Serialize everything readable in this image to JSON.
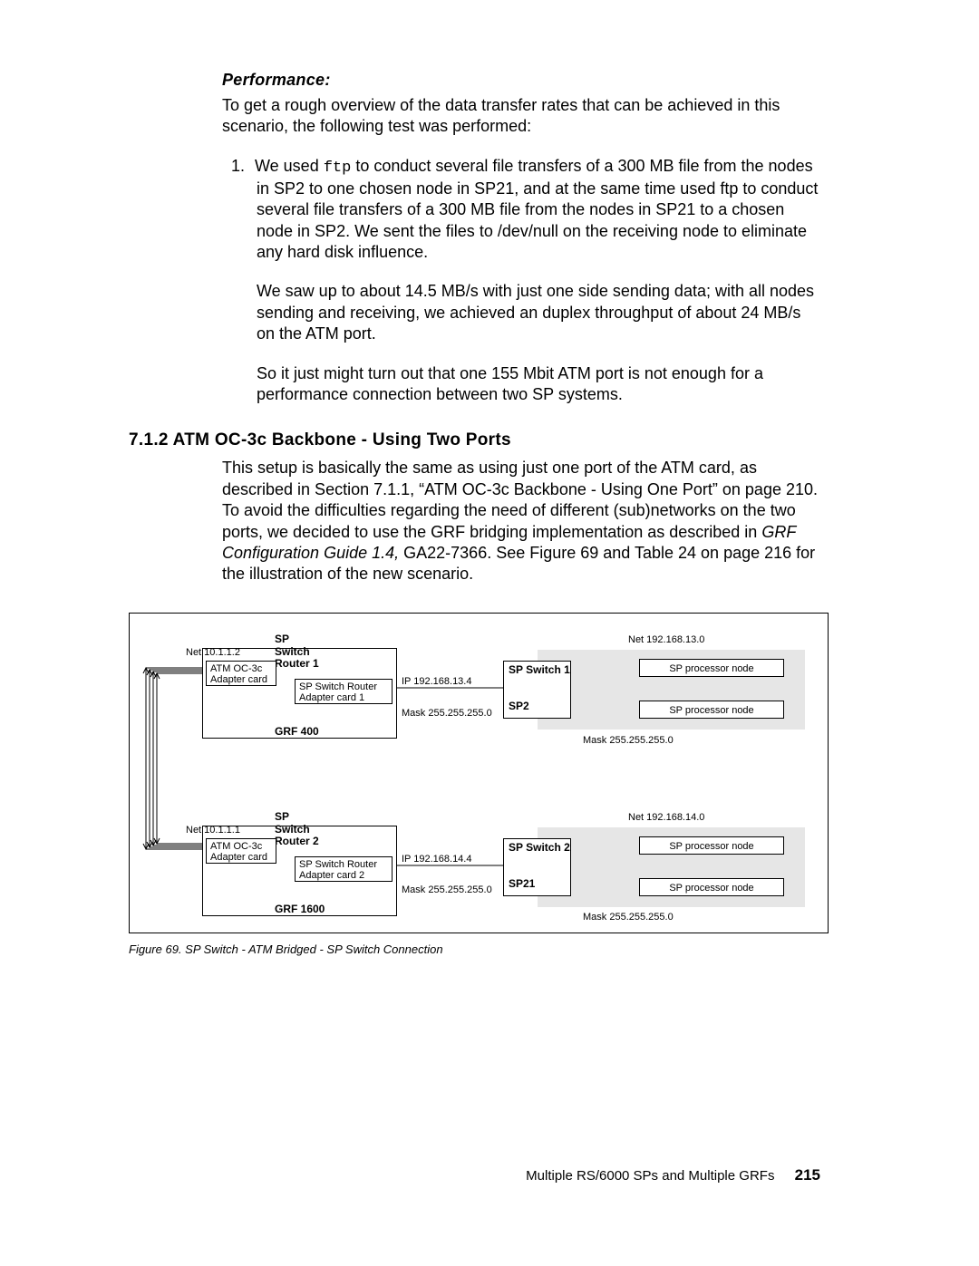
{
  "performance": {
    "heading": "Performance:",
    "intro": "To get a rough overview of the data transfer rates that can be achieved in this scenario, the following test was performed:",
    "item_number": "1.",
    "item_text_a": "We used ",
    "item_text_ftp": "ftp",
    "item_text_b": " to conduct several file transfers of a 300 MB file from the nodes in SP2 to one chosen node in SP21, and at the same time used ftp to conduct several file transfers of a 300 MB file from the nodes in SP21 to a chosen node in SP2. We sent the files to /dev/null on the receiving node to eliminate any hard disk influence.",
    "p2": "We saw up to about 14.5 MB/s with just one side sending data; with all nodes sending and receiving, we achieved an duplex throughput of about 24 MB/s on the ATM port.",
    "p3": "So it just might turn out that one 155 Mbit ATM port is not enough for a performance connection between two SP systems."
  },
  "section": {
    "heading": "7.1.2  ATM OC-3c Backbone - Using Two Ports",
    "body_a": "This setup is basically the same as using just one port of the ATM card, as described in Section 7.1.1, “ATM OC-3c Backbone - Using One Port” on page 210. To avoid the difficulties regarding the need of different (sub)networks on the two ports, we decided to use the GRF bridging implementation as described in ",
    "body_ref": "GRF Configuration Guide 1.4,",
    "body_b": " GA22-7366. See Figure 69 and Table 24 on page 216 for the illustration of the new scenario."
  },
  "figure": {
    "caption": "Figure 69.  SP Switch - ATM Bridged - SP Switch Connection",
    "router1": {
      "title": "SP\nSwitch\nRouter 1",
      "device": "GRF 400",
      "atm_card": "ATM OC-3c\nAdapter card",
      "sp_card": "SP Switch Router\nAdapter card 1",
      "net_left": "Net 10.1.1.2",
      "ip": "IP 192.168.13.4",
      "mask": "Mask 255.255.255.0"
    },
    "router2": {
      "title": "SP\nSwitch\nRouter 2",
      "device": "GRF 1600",
      "atm_card": "ATM OC-3c\nAdapter card",
      "sp_card": "SP Switch Router\nAdapter card 2",
      "net_left": "Net 10.1.1.1",
      "ip": "IP 192.168.14.4",
      "mask": "Mask 255.255.255.0"
    },
    "sp1": {
      "switch_label": "SP Switch 1",
      "name": "SP2",
      "net": "Net 192.168.13.0",
      "mask": "Mask 255.255.255.0",
      "node": "SP processor node"
    },
    "sp2": {
      "switch_label": "SP Switch 2",
      "name": "SP21",
      "net": "Net 192.168.14.0",
      "mask": "Mask 255.255.255.0",
      "node": "SP processor node"
    }
  },
  "footer": {
    "section": "Multiple RS/6000 SPs and Multiple GRFs",
    "page": "215"
  }
}
